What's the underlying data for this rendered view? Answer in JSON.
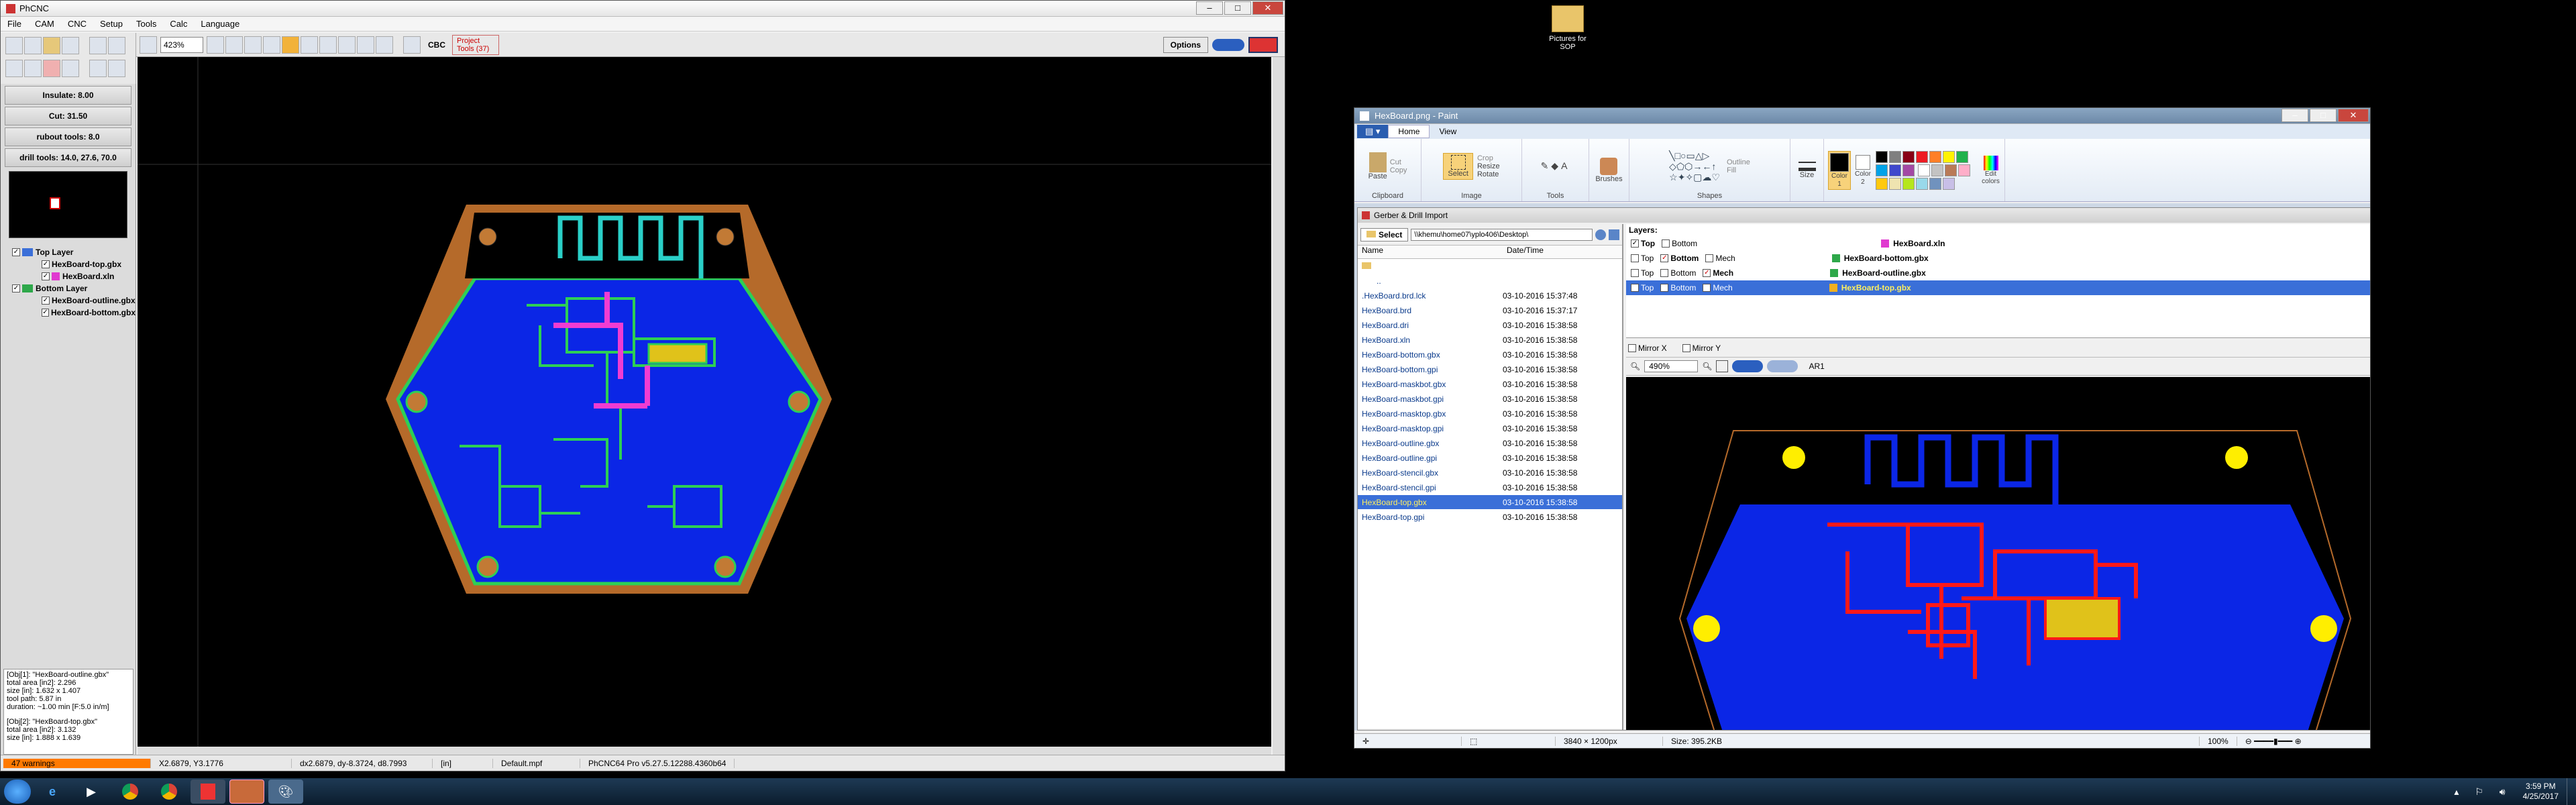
{
  "phcnc": {
    "title": "PhCNC",
    "menu": [
      "File",
      "CAM",
      "CNC",
      "Setup",
      "Tools",
      "Calc",
      "Language"
    ],
    "zoom": "423%",
    "cbc": "CBC",
    "project_tools": "Project Tools (37)",
    "options": "Options",
    "side_tools": [
      "Insulate: 8.00",
      "Cut: 31.50",
      "rubout tools: 8.0",
      "drill tools: 14.0, 27.6, 70.0"
    ],
    "tree": [
      {
        "label": "Top Layer",
        "level": 0
      },
      {
        "label": "HexBoard-top.gbx",
        "level": 1
      },
      {
        "label": "HexBoard.xln",
        "level": 1
      },
      {
        "label": "Bottom Layer",
        "level": 0
      },
      {
        "label": "HexBoard-outline.gbx",
        "level": 1
      },
      {
        "label": "HexBoard-bottom.gbx",
        "level": 1
      }
    ],
    "info_lines": [
      "[Obj[1]: \"HexBoard-outline.gbx\"",
      "total area [in2]: 2.296",
      "size [in]: 1.632 x 1.407",
      "tool path: 5.87 in",
      "duration: ~1.00 min [F:5.0 in/m]",
      "",
      "[Obj[2]: \"HexBoard-top.gbx\"",
      "total area [in2]: 3.132",
      "size [in]: 1.888 x 1.639"
    ],
    "status": {
      "warnings": "47 warnings",
      "coords": "X2.6879, Y3.1776",
      "delta": "dx2.6879, dy-8.3724, d8.7993",
      "units": "[in]",
      "profile": "Default.mpf",
      "version": "PhCNC64 Pro v5.27.5.12288.4360b64"
    }
  },
  "desktop_icon": {
    "label": "Pictures for SOP"
  },
  "paint": {
    "title": "HexBoard.png - Paint",
    "tabs": [
      "Home",
      "View"
    ],
    "groups": {
      "clipboard": "Clipboard",
      "image": "Image",
      "tools": "Tools",
      "shapes": "Shapes",
      "colors": "Colors"
    },
    "buttons": {
      "paste": "Paste",
      "cut": "Cut",
      "copy": "Copy",
      "select": "Select",
      "crop": "Crop",
      "resize": "Resize",
      "rotate": "Rotate",
      "brushes": "Brushes",
      "outline": "Outline",
      "fill": "Fill",
      "size": "Size",
      "color1": "Color 1",
      "color2": "Color 2",
      "edit_colors": "Edit colors"
    },
    "palette": [
      "#000000",
      "#7f7f7f",
      "#880015",
      "#ed1c24",
      "#ff7f27",
      "#fff200",
      "#22b14c",
      "#00a2e8",
      "#3f48cc",
      "#a349a4",
      "#ffffff",
      "#c3c3c3",
      "#b97a57",
      "#ffaec9",
      "#ffc90e",
      "#efe4b0",
      "#b5e61d",
      "#99d9ea",
      "#7092be",
      "#c8bfe7"
    ],
    "status": {
      "dims": "3840 × 1200px",
      "size": "Size: 395.2KB",
      "zoom": "100%"
    }
  },
  "gerber": {
    "title": "Gerber & Drill Import",
    "select_label": "Select",
    "path": "\\\\khemu\\home07\\yplo406\\Desktop\\",
    "col_name": "Name",
    "col_date": "Date/Time",
    "files": [
      {
        "name": "..",
        "date": ""
      },
      {
        "name": ".HexBoard.brd.lck",
        "date": "03-10-2016 15:37:48"
      },
      {
        "name": "HexBoard.brd",
        "date": "03-10-2016 15:37:17"
      },
      {
        "name": "HexBoard.dri",
        "date": "03-10-2016 15:38:58"
      },
      {
        "name": "HexBoard.xln",
        "date": "03-10-2016 15:38:58"
      },
      {
        "name": "HexBoard-bottom.gbx",
        "date": "03-10-2016 15:38:58"
      },
      {
        "name": "HexBoard-bottom.gpi",
        "date": "03-10-2016 15:38:58"
      },
      {
        "name": "HexBoard-maskbot.gbx",
        "date": "03-10-2016 15:38:58"
      },
      {
        "name": "HexBoard-maskbot.gpi",
        "date": "03-10-2016 15:38:58"
      },
      {
        "name": "HexBoard-masktop.gbx",
        "date": "03-10-2016 15:38:58"
      },
      {
        "name": "HexBoard-masktop.gpi",
        "date": "03-10-2016 15:38:58"
      },
      {
        "name": "HexBoard-outline.gbx",
        "date": "03-10-2016 15:38:58"
      },
      {
        "name": "HexBoard-outline.gpi",
        "date": "03-10-2016 15:38:58"
      },
      {
        "name": "HexBoard-stencil.gbx",
        "date": "03-10-2016 15:38:58"
      },
      {
        "name": "HexBoard-stencil.gpi",
        "date": "03-10-2016 15:38:58"
      },
      {
        "name": "HexBoard-top.gbx",
        "date": "03-10-2016 15:38:58",
        "selected": true
      },
      {
        "name": "HexBoard-top.gpi",
        "date": "03-10-2016 15:38:58"
      }
    ],
    "layers_label": "Layers:",
    "layer_rows": [
      {
        "file": "HexBoard.xln"
      },
      {
        "file": "HexBoard-bottom.gbx"
      },
      {
        "file": "HexBoard-outline.gbx"
      },
      {
        "file": "HexBoard-top.gbx",
        "selected": true
      }
    ],
    "layer_opts": {
      "top": "Top",
      "bottom": "Bottom",
      "mech": "Mech"
    },
    "mirror_x": "Mirror X",
    "mirror_y": "Mirror Y",
    "zoom": "490%",
    "ratio": "AR1"
  },
  "taskbar": {
    "time": "3:59 PM",
    "date": "4/25/2017"
  }
}
